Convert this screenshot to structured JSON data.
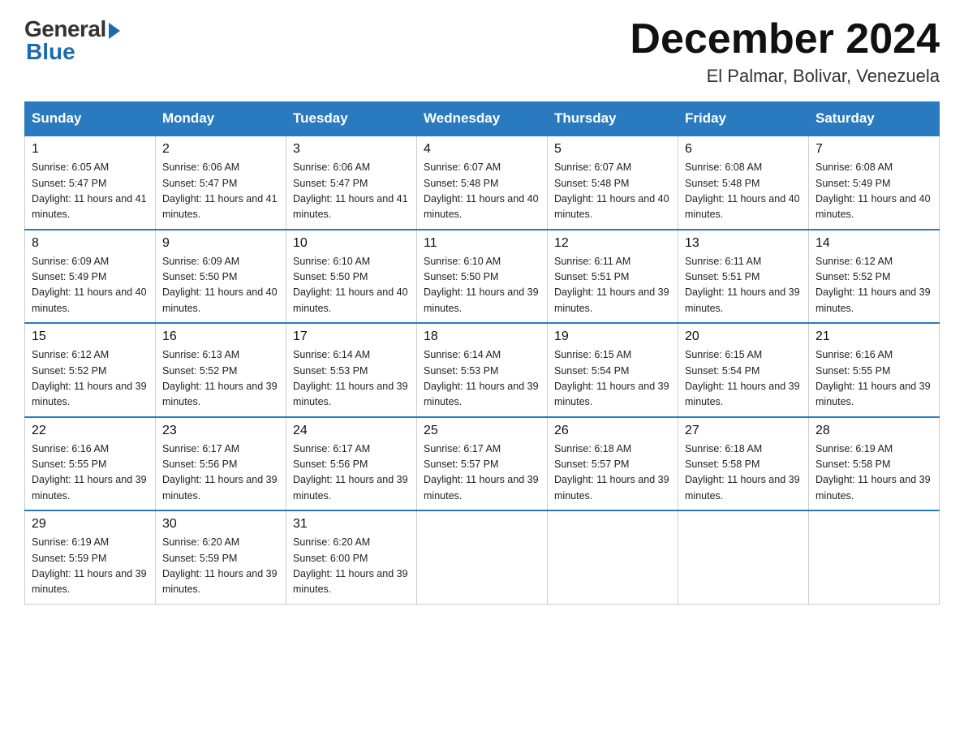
{
  "logo": {
    "general": "General",
    "blue": "Blue"
  },
  "header": {
    "month": "December 2024",
    "location": "El Palmar, Bolivar, Venezuela"
  },
  "days_of_week": [
    "Sunday",
    "Monday",
    "Tuesday",
    "Wednesday",
    "Thursday",
    "Friday",
    "Saturday"
  ],
  "weeks": [
    [
      {
        "day": "1",
        "sunrise": "6:05 AM",
        "sunset": "5:47 PM",
        "daylight": "11 hours and 41 minutes."
      },
      {
        "day": "2",
        "sunrise": "6:06 AM",
        "sunset": "5:47 PM",
        "daylight": "11 hours and 41 minutes."
      },
      {
        "day": "3",
        "sunrise": "6:06 AM",
        "sunset": "5:47 PM",
        "daylight": "11 hours and 41 minutes."
      },
      {
        "day": "4",
        "sunrise": "6:07 AM",
        "sunset": "5:48 PM",
        "daylight": "11 hours and 40 minutes."
      },
      {
        "day": "5",
        "sunrise": "6:07 AM",
        "sunset": "5:48 PM",
        "daylight": "11 hours and 40 minutes."
      },
      {
        "day": "6",
        "sunrise": "6:08 AM",
        "sunset": "5:48 PM",
        "daylight": "11 hours and 40 minutes."
      },
      {
        "day": "7",
        "sunrise": "6:08 AM",
        "sunset": "5:49 PM",
        "daylight": "11 hours and 40 minutes."
      }
    ],
    [
      {
        "day": "8",
        "sunrise": "6:09 AM",
        "sunset": "5:49 PM",
        "daylight": "11 hours and 40 minutes."
      },
      {
        "day": "9",
        "sunrise": "6:09 AM",
        "sunset": "5:50 PM",
        "daylight": "11 hours and 40 minutes."
      },
      {
        "day": "10",
        "sunrise": "6:10 AM",
        "sunset": "5:50 PM",
        "daylight": "11 hours and 40 minutes."
      },
      {
        "day": "11",
        "sunrise": "6:10 AM",
        "sunset": "5:50 PM",
        "daylight": "11 hours and 39 minutes."
      },
      {
        "day": "12",
        "sunrise": "6:11 AM",
        "sunset": "5:51 PM",
        "daylight": "11 hours and 39 minutes."
      },
      {
        "day": "13",
        "sunrise": "6:11 AM",
        "sunset": "5:51 PM",
        "daylight": "11 hours and 39 minutes."
      },
      {
        "day": "14",
        "sunrise": "6:12 AM",
        "sunset": "5:52 PM",
        "daylight": "11 hours and 39 minutes."
      }
    ],
    [
      {
        "day": "15",
        "sunrise": "6:12 AM",
        "sunset": "5:52 PM",
        "daylight": "11 hours and 39 minutes."
      },
      {
        "day": "16",
        "sunrise": "6:13 AM",
        "sunset": "5:52 PM",
        "daylight": "11 hours and 39 minutes."
      },
      {
        "day": "17",
        "sunrise": "6:14 AM",
        "sunset": "5:53 PM",
        "daylight": "11 hours and 39 minutes."
      },
      {
        "day": "18",
        "sunrise": "6:14 AM",
        "sunset": "5:53 PM",
        "daylight": "11 hours and 39 minutes."
      },
      {
        "day": "19",
        "sunrise": "6:15 AM",
        "sunset": "5:54 PM",
        "daylight": "11 hours and 39 minutes."
      },
      {
        "day": "20",
        "sunrise": "6:15 AM",
        "sunset": "5:54 PM",
        "daylight": "11 hours and 39 minutes."
      },
      {
        "day": "21",
        "sunrise": "6:16 AM",
        "sunset": "5:55 PM",
        "daylight": "11 hours and 39 minutes."
      }
    ],
    [
      {
        "day": "22",
        "sunrise": "6:16 AM",
        "sunset": "5:55 PM",
        "daylight": "11 hours and 39 minutes."
      },
      {
        "day": "23",
        "sunrise": "6:17 AM",
        "sunset": "5:56 PM",
        "daylight": "11 hours and 39 minutes."
      },
      {
        "day": "24",
        "sunrise": "6:17 AM",
        "sunset": "5:56 PM",
        "daylight": "11 hours and 39 minutes."
      },
      {
        "day": "25",
        "sunrise": "6:17 AM",
        "sunset": "5:57 PM",
        "daylight": "11 hours and 39 minutes."
      },
      {
        "day": "26",
        "sunrise": "6:18 AM",
        "sunset": "5:57 PM",
        "daylight": "11 hours and 39 minutes."
      },
      {
        "day": "27",
        "sunrise": "6:18 AM",
        "sunset": "5:58 PM",
        "daylight": "11 hours and 39 minutes."
      },
      {
        "day": "28",
        "sunrise": "6:19 AM",
        "sunset": "5:58 PM",
        "daylight": "11 hours and 39 minutes."
      }
    ],
    [
      {
        "day": "29",
        "sunrise": "6:19 AM",
        "sunset": "5:59 PM",
        "daylight": "11 hours and 39 minutes."
      },
      {
        "day": "30",
        "sunrise": "6:20 AM",
        "sunset": "5:59 PM",
        "daylight": "11 hours and 39 minutes."
      },
      {
        "day": "31",
        "sunrise": "6:20 AM",
        "sunset": "6:00 PM",
        "daylight": "11 hours and 39 minutes."
      },
      null,
      null,
      null,
      null
    ]
  ],
  "labels": {
    "sunrise_prefix": "Sunrise: ",
    "sunset_prefix": "Sunset: ",
    "daylight_prefix": "Daylight: "
  }
}
